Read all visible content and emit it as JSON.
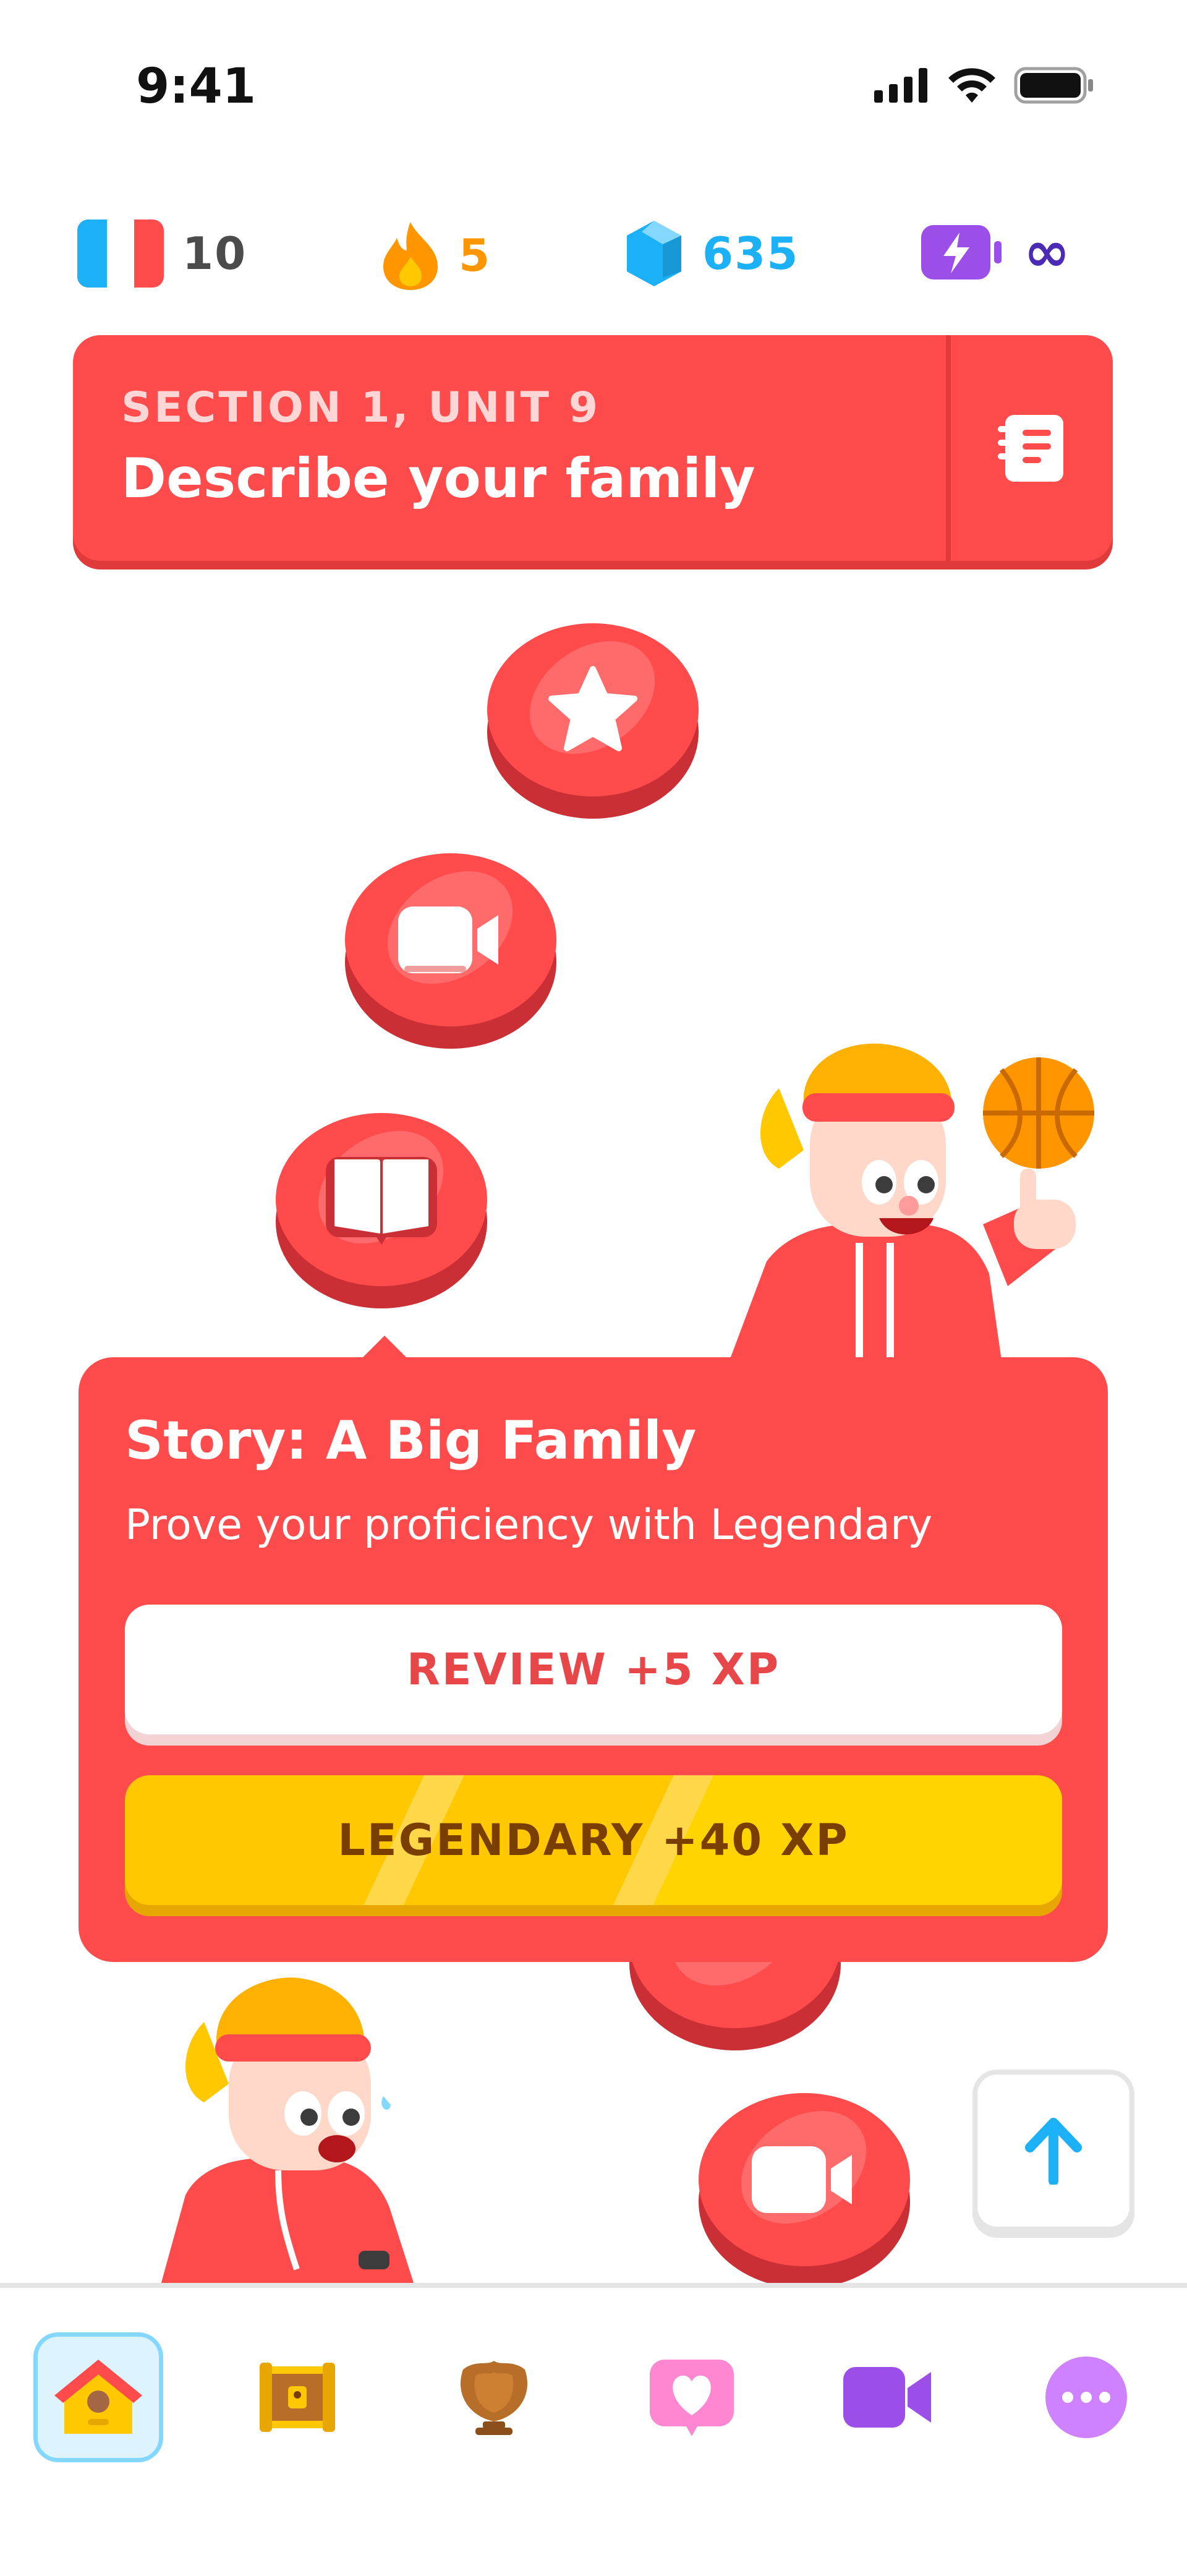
{
  "status_bar": {
    "time": "9:41"
  },
  "stats": {
    "course_count": "10",
    "streak": "5",
    "gems": "635",
    "energy": "∞"
  },
  "colors": {
    "brand_red": "#ff4b4b",
    "gold": "#ffc800",
    "gem_blue": "#1cb0f6",
    "energy_purple": "#9b4ee8"
  },
  "unit": {
    "section_label": "SECTION 1, UNIT 9",
    "title": "Describe your family"
  },
  "path_nodes": [
    {
      "type": "star-icon"
    },
    {
      "type": "video-icon"
    },
    {
      "type": "book-icon"
    },
    {
      "type": "video-icon"
    }
  ],
  "popover": {
    "title": "Story: A Big Family",
    "subtitle": "Prove your proficiency with Legendary",
    "review_label": "REVIEW +5 XP",
    "legendary_label": "LEGENDARY +40 XP"
  },
  "tabs": [
    {
      "name": "home",
      "icon": "house-icon",
      "active": true
    },
    {
      "name": "treasure",
      "icon": "chest-icon"
    },
    {
      "name": "leagues",
      "icon": "shield-icon"
    },
    {
      "name": "hearts",
      "icon": "heart-icon"
    },
    {
      "name": "video",
      "icon": "video-icon"
    },
    {
      "name": "more",
      "icon": "more-icon"
    }
  ]
}
